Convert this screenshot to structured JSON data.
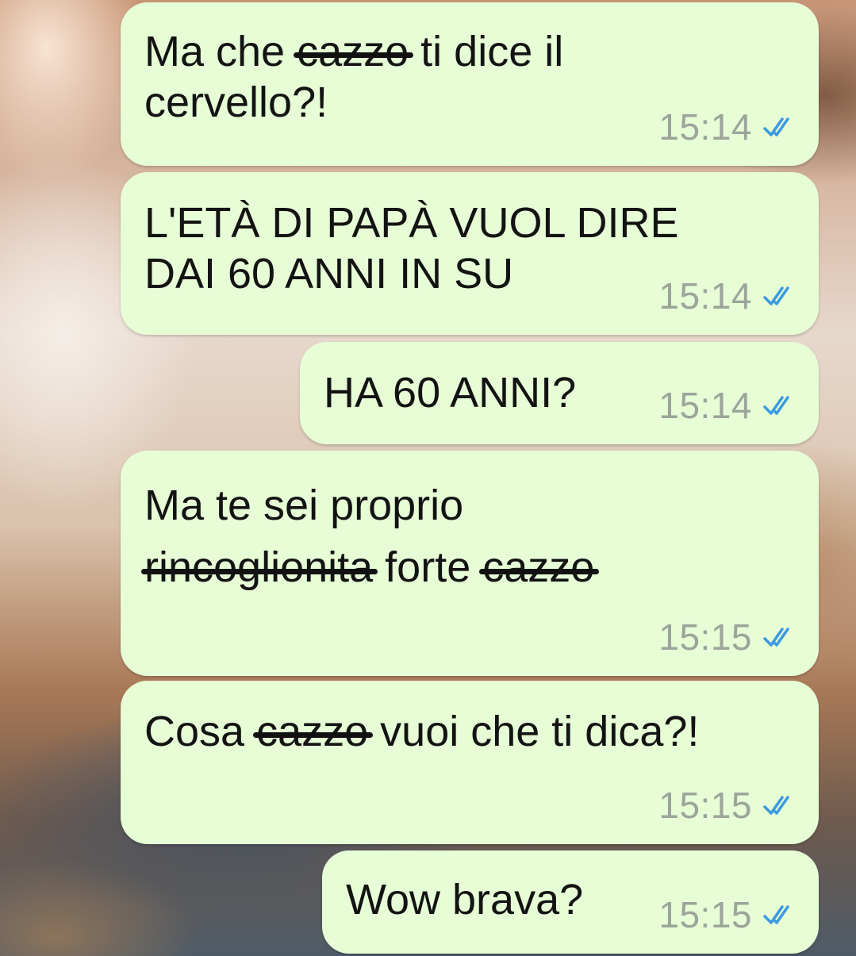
{
  "messages": [
    {
      "segments": [
        {
          "text": "Ma che "
        },
        {
          "text": "cazzo",
          "strike": true
        },
        {
          "text": " ti dice il\ncervello?!"
        }
      ],
      "time": "15:14",
      "status": "double-check-read"
    },
    {
      "segments": [
        {
          "text": "L'ETÀ DI PAPÀ VUOL DIRE\nDAI 60 ANNI IN SU"
        }
      ],
      "time": "15:14",
      "status": "double-check-read"
    },
    {
      "segments": [
        {
          "text": "HA 60 ANNI?"
        }
      ],
      "time": "15:14",
      "status": "double-check-read"
    },
    {
      "segments": [
        {
          "text": "Ma te sei proprio\n"
        },
        {
          "text": "rincoglionita",
          "strike": true
        },
        {
          "text": " forte "
        },
        {
          "text": "cazzo",
          "strike": true
        }
      ],
      "time": "15:15",
      "status": "double-check-read"
    },
    {
      "segments": [
        {
          "text": "Cosa "
        },
        {
          "text": "cazzo",
          "strike": true
        },
        {
          "text": " vuoi che ti dica?!"
        }
      ],
      "time": "15:15",
      "status": "double-check-read"
    },
    {
      "segments": [
        {
          "text": "Wow brava?"
        }
      ],
      "time": "15:15",
      "status": "double-check-read"
    }
  ],
  "colors": {
    "bubble": "#e6fdd6",
    "text": "#131313",
    "time": "#9ba59a",
    "read_tick": "#3b9ae0"
  }
}
